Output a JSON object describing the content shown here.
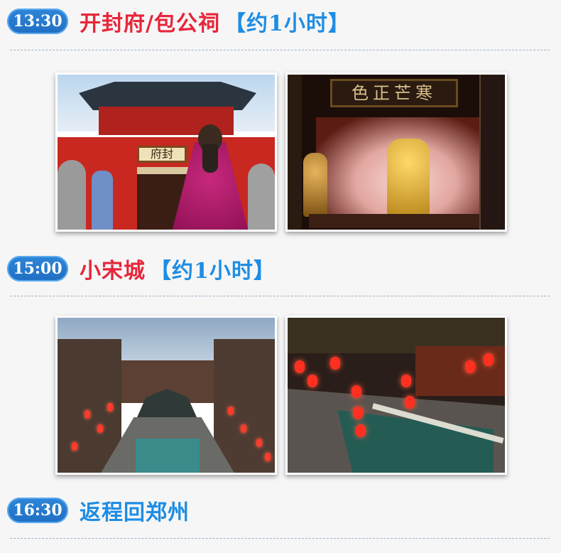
{
  "stops": [
    {
      "time": "13:30",
      "place": "开封府/包公祠",
      "duration": "【约1小时】",
      "photos": [
        {
          "icon": "kaifeng-fu-gate-photo",
          "plaque_text": "府封"
        },
        {
          "icon": "baogong-temple-statue-photo",
          "plaque_text": "色正芒寒"
        }
      ]
    },
    {
      "time": "15:00",
      "place": "小宋城",
      "duration": "【约1小时】",
      "photos": [
        {
          "icon": "xiaosongcheng-overview-photo"
        },
        {
          "icon": "xiaosongcheng-canal-photo"
        }
      ]
    },
    {
      "time": "16:30",
      "place": "返程回郑州",
      "duration": ""
    }
  ],
  "colors": {
    "badge": "#1f6fc3",
    "place_red": "#e8253a",
    "place_blue": "#1e8de4",
    "divider": "#9ab0c8"
  }
}
